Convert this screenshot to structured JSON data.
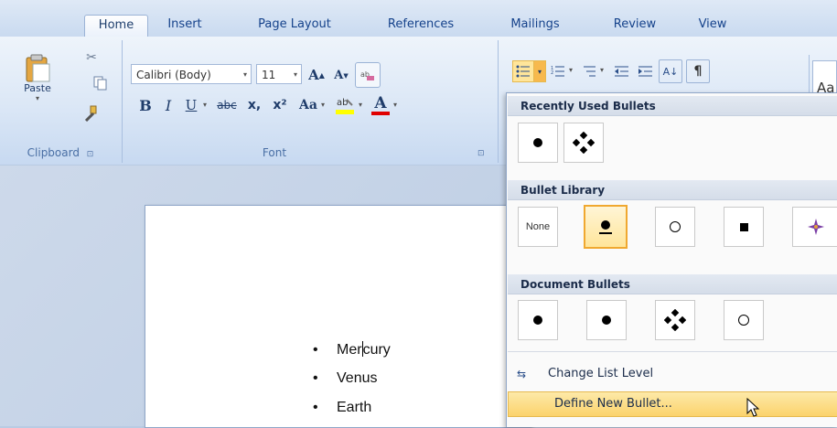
{
  "tabs": [
    {
      "label": "Home",
      "active": true
    },
    {
      "label": "Insert"
    },
    {
      "label": "Page Layout"
    },
    {
      "label": "References"
    },
    {
      "label": "Mailings"
    },
    {
      "label": "Review"
    },
    {
      "label": "View"
    }
  ],
  "clipboard": {
    "paste_label": "Paste",
    "group_label": "Clipboard"
  },
  "font": {
    "font_name": "Calibri (Body)",
    "font_size": "11",
    "group_label": "Font",
    "bold": "B",
    "italic": "I",
    "underline": "U",
    "strike": "abc",
    "subscript": "x,",
    "superscript": "x²",
    "change_case": "Aa",
    "grow": "A",
    "shrink": "A",
    "highlight": "ab",
    "font_color": "A"
  },
  "paragraph": {
    "sort": "A↓",
    "pilcrow": "¶"
  },
  "styles": {
    "preview": "Aa"
  },
  "document": {
    "items": [
      "Mercury",
      "Venus",
      "Earth"
    ],
    "bullet": "•"
  },
  "menu": {
    "recently_used_header": "Recently Used Bullets",
    "library_header": "Bullet Library",
    "document_header": "Document Bullets",
    "none_label": "None",
    "change_level": "Change List Level",
    "define_new": "Define New Bullet..."
  },
  "colors": {
    "accent": "#15428b",
    "highlight": "#f0a830",
    "ribbon": "#dbe7f6"
  }
}
